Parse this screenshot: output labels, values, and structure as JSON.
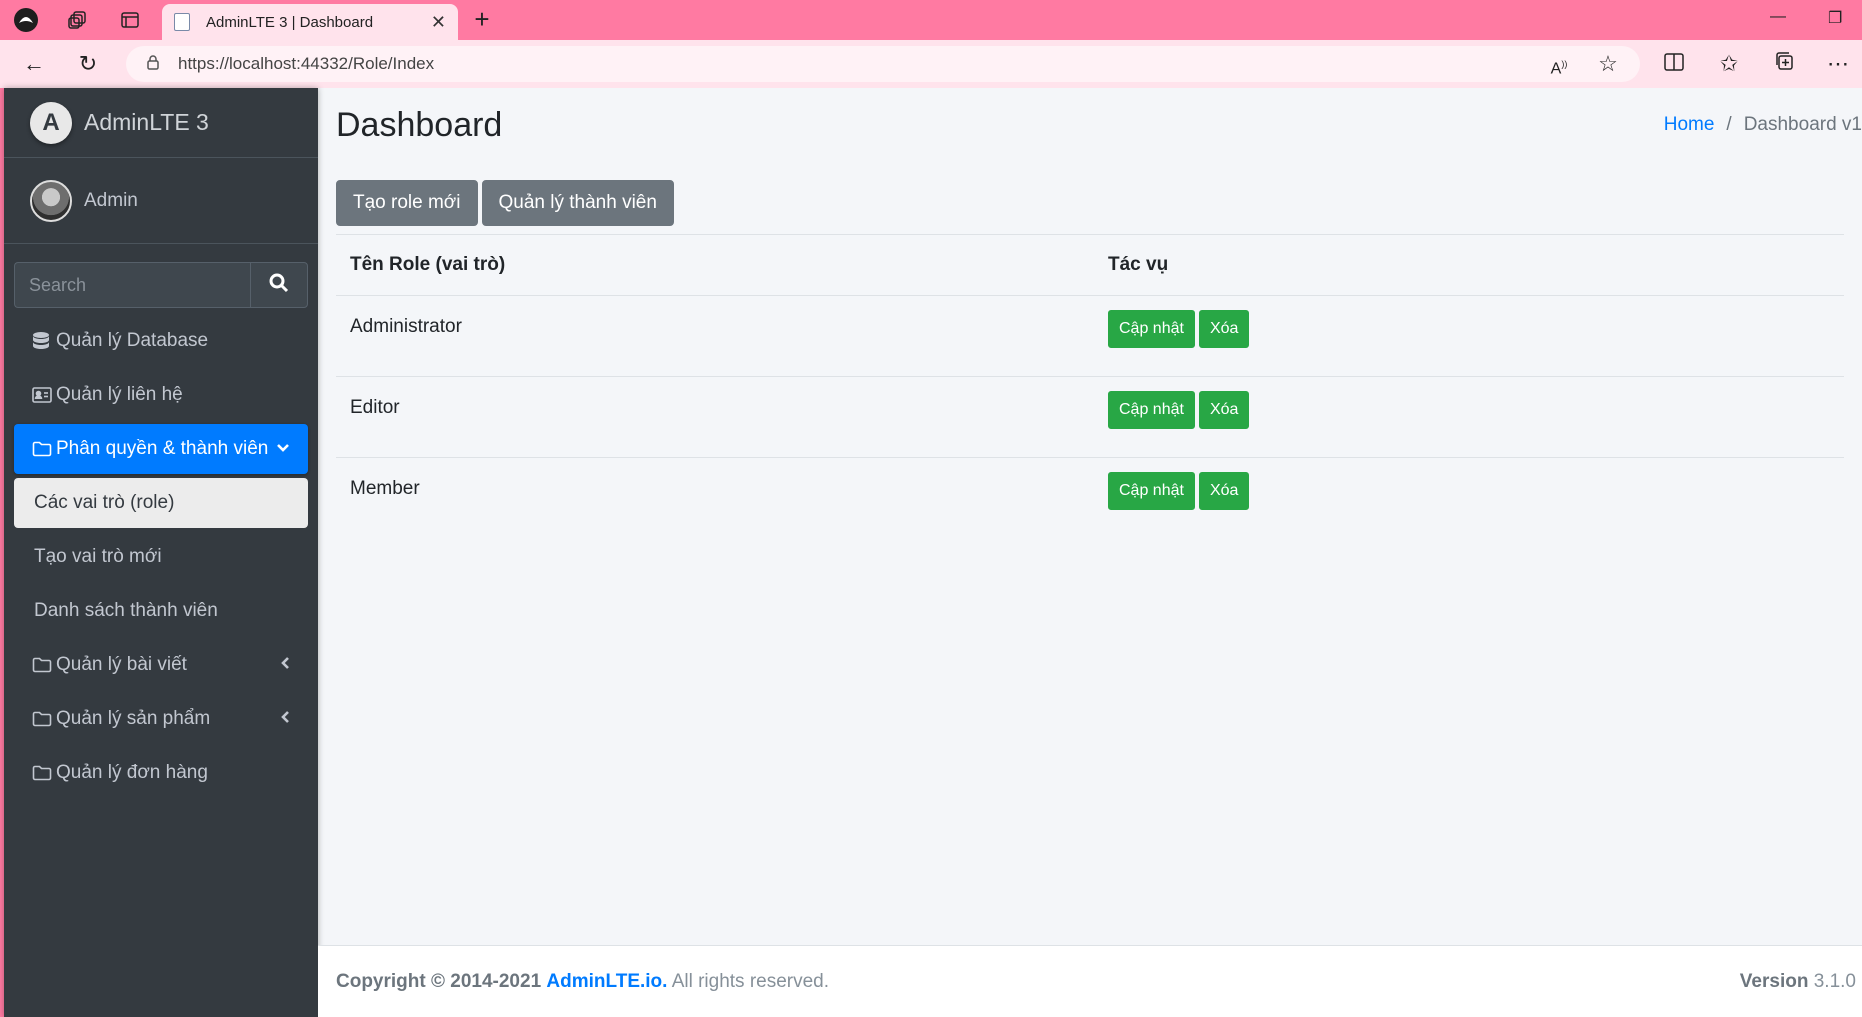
{
  "browser": {
    "tab_title": "AdminLTE 3 | Dashboard",
    "url": "https://localhost:44332/Role/Index"
  },
  "sidebar": {
    "brand": "AdminLTE 3",
    "user": "Admin",
    "search_placeholder": "Search",
    "items": [
      {
        "label": "Quản lý Database"
      },
      {
        "label": "Quản lý liên hệ"
      },
      {
        "label": "Phân quyền & thành viên"
      },
      {
        "label": "Các vai trò (role)"
      },
      {
        "label": "Tạo vai trò mới"
      },
      {
        "label": "Danh sách thành viên"
      },
      {
        "label": "Quản lý bài viết"
      },
      {
        "label": "Quản lý sản phẩm"
      },
      {
        "label": "Quản lý đơn hàng"
      }
    ]
  },
  "header": {
    "title": "Dashboard",
    "breadcrumb_home": "Home",
    "breadcrumb_current": "Dashboard v1"
  },
  "actions": {
    "new_role": "Tạo role mới",
    "manage_members": "Quản lý thành viên"
  },
  "table": {
    "columns": [
      "Tên Role (vai trò)",
      "Tác vụ"
    ],
    "rows": [
      {
        "name": "Administrator",
        "update": "Cập nhật",
        "delete": "Xóa"
      },
      {
        "name": "Editor",
        "update": "Cập nhật",
        "delete": "Xóa"
      },
      {
        "name": "Member",
        "update": "Cập nhật",
        "delete": "Xóa"
      }
    ]
  },
  "footer": {
    "copyright": "Copyright © 2014-2021",
    "link": "AdminLTE.io.",
    "rights": "All rights reserved.",
    "version_label": "Version",
    "version": "3.1.0"
  }
}
